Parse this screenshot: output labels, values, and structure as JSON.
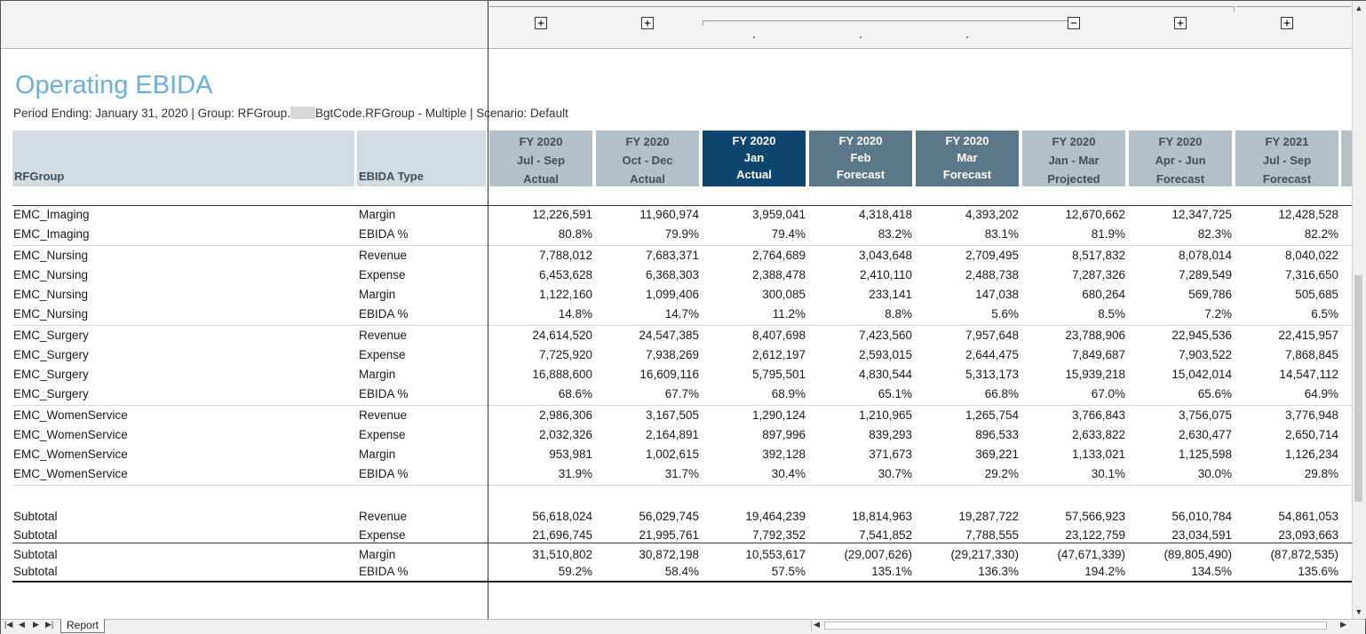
{
  "report": {
    "title": "Operating EBIDA",
    "subtitle_pre": "Period Ending: January 31, 2020 | Group: RFGroup.",
    "subtitle_post": "BgtCode.RFGroup - Multiple | Scenario: Default"
  },
  "group_buttons": [
    "+",
    "+",
    "−",
    "+",
    "+"
  ],
  "row_headers": {
    "group": "RFGroup",
    "type": "EBIDA Type"
  },
  "columns": [
    {
      "year": "FY 2020",
      "period": "Jul - Sep",
      "kind": "Actual",
      "style": "normal"
    },
    {
      "year": "FY 2020",
      "period": "Oct - Dec",
      "kind": "Actual",
      "style": "normal"
    },
    {
      "year": "FY 2020",
      "period": "Jan",
      "kind": "Actual",
      "style": "current"
    },
    {
      "year": "FY 2020",
      "period": "Feb",
      "kind": "Forecast",
      "style": "month"
    },
    {
      "year": "FY 2020",
      "period": "Mar",
      "kind": "Forecast",
      "style": "month"
    },
    {
      "year": "FY 2020",
      "period": "Jan - Mar",
      "kind": "Projected",
      "style": "normal"
    },
    {
      "year": "FY 2020",
      "period": "Apr - Jun",
      "kind": "Forecast",
      "style": "normal"
    },
    {
      "year": "FY 2021",
      "period": "Jul - Sep",
      "kind": "Forecast",
      "style": "normal"
    }
  ],
  "colors": {
    "header_normal": "#b4c0c9",
    "header_current": "#0f4670",
    "header_month": "#5c7787",
    "title": "#6aaee0"
  },
  "rows": [
    {
      "group": "EMC_Imaging",
      "type": "Margin",
      "values": [
        "12,226,591",
        "11,960,974",
        "3,959,041",
        "4,318,418",
        "4,393,202",
        "12,670,662",
        "12,347,725",
        "12,428,528"
      ]
    },
    {
      "group": "EMC_Imaging",
      "type": "EBIDA %",
      "values": [
        "80.8%",
        "79.9%",
        "79.4%",
        "83.2%",
        "83.1%",
        "81.9%",
        "82.3%",
        "82.2%"
      ]
    },
    {
      "group": "EMC_Nursing",
      "type": "Revenue",
      "values": [
        "7,788,012",
        "7,683,371",
        "2,764,689",
        "3,043,648",
        "2,709,495",
        "8,517,832",
        "8,078,014",
        "8,040,022"
      ]
    },
    {
      "group": "EMC_Nursing",
      "type": "Expense",
      "values": [
        "6,453,628",
        "6,368,303",
        "2,388,478",
        "2,410,110",
        "2,488,738",
        "7,287,326",
        "7,289,549",
        "7,316,650"
      ]
    },
    {
      "group": "EMC_Nursing",
      "type": "Margin",
      "values": [
        "1,122,160",
        "1,099,406",
        "300,085",
        "233,141",
        "147,038",
        "680,264",
        "569,786",
        "505,685"
      ]
    },
    {
      "group": "EMC_Nursing",
      "type": "EBIDA %",
      "values": [
        "14.8%",
        "14.7%",
        "11.2%",
        "8.8%",
        "5.6%",
        "8.5%",
        "7.2%",
        "6.5%"
      ]
    },
    {
      "group": "EMC_Surgery",
      "type": "Revenue",
      "values": [
        "24,614,520",
        "24,547,385",
        "8,407,698",
        "7,423,560",
        "7,957,648",
        "23,788,906",
        "22,945,536",
        "22,415,957"
      ]
    },
    {
      "group": "EMC_Surgery",
      "type": "Expense",
      "values": [
        "7,725,920",
        "7,938,269",
        "2,612,197",
        "2,593,015",
        "2,644,475",
        "7,849,687",
        "7,903,522",
        "7,868,845"
      ]
    },
    {
      "group": "EMC_Surgery",
      "type": "Margin",
      "values": [
        "16,888,600",
        "16,609,116",
        "5,795,501",
        "4,830,544",
        "5,313,173",
        "15,939,218",
        "15,042,014",
        "14,547,112"
      ]
    },
    {
      "group": "EMC_Surgery",
      "type": "EBIDA %",
      "values": [
        "68.6%",
        "67.7%",
        "68.9%",
        "65.1%",
        "66.8%",
        "67.0%",
        "65.6%",
        "64.9%"
      ]
    },
    {
      "group": "EMC_WomenService",
      "type": "Revenue",
      "values": [
        "2,986,306",
        "3,167,505",
        "1,290,124",
        "1,210,965",
        "1,265,754",
        "3,766,843",
        "3,756,075",
        "3,776,948"
      ]
    },
    {
      "group": "EMC_WomenService",
      "type": "Expense",
      "values": [
        "2,032,326",
        "2,164,891",
        "897,996",
        "839,293",
        "896,533",
        "2,633,822",
        "2,630,477",
        "2,650,714"
      ]
    },
    {
      "group": "EMC_WomenService",
      "type": "Margin",
      "values": [
        "953,981",
        "1,002,615",
        "392,128",
        "371,673",
        "369,221",
        "1,133,021",
        "1,125,598",
        "1,126,234"
      ]
    },
    {
      "group": "EMC_WomenService",
      "type": "EBIDA %",
      "values": [
        "31.9%",
        "31.7%",
        "30.4%",
        "30.7%",
        "29.2%",
        "30.1%",
        "30.0%",
        "29.8%"
      ]
    },
    {
      "group": "Subtotal",
      "type": "Revenue",
      "values": [
        "56,618,024",
        "56,029,745",
        "19,464,239",
        "18,814,963",
        "19,287,722",
        "57,566,923",
        "56,010,784",
        "54,861,053"
      ]
    },
    {
      "group": "Subtotal",
      "type": "Expense",
      "values": [
        "21,696,745",
        "21,995,761",
        "7,792,352",
        "7,541,852",
        "7,788,555",
        "23,122,759",
        "23,034,591",
        "23,093,663"
      ]
    },
    {
      "group": "Subtotal",
      "type": "Margin",
      "values": [
        "31,510,802",
        "30,872,198",
        "10,553,617",
        "(29,007,626)",
        "(29,217,330)",
        "(47,671,339)",
        "(89,805,490)",
        "(87,872,535)"
      ]
    },
    {
      "group": "Subtotal",
      "type": "EBIDA %",
      "values": [
        "59.2%",
        "58.4%",
        "57.5%",
        "135.1%",
        "136.3%",
        "194.2%",
        "134.5%",
        "135.6%"
      ]
    }
  ],
  "sheet_tab": "Report"
}
